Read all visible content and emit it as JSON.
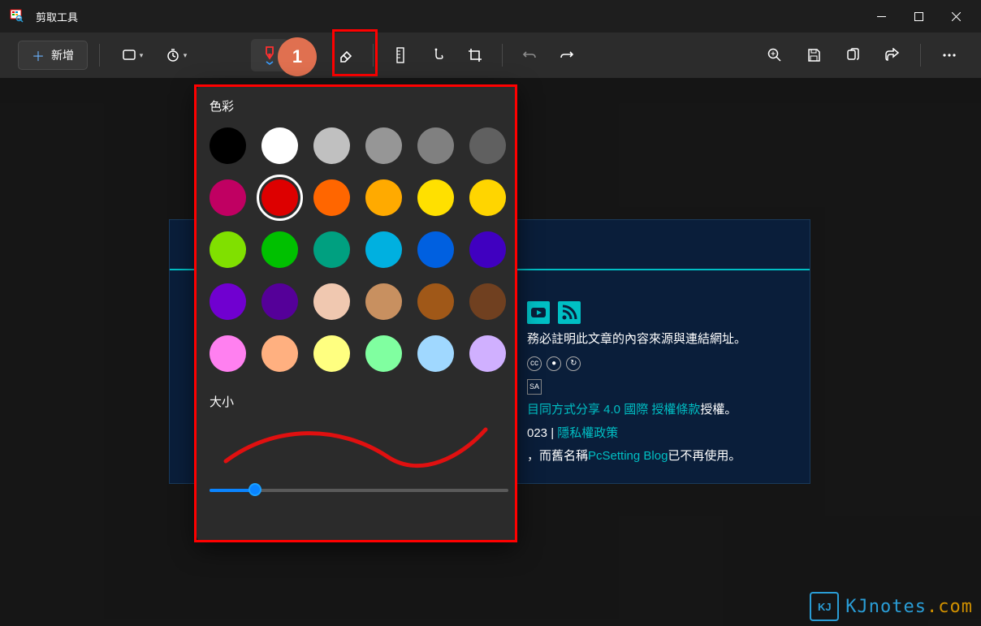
{
  "window": {
    "title": "剪取工具"
  },
  "toolbar": {
    "new_label": "新增"
  },
  "callout": {
    "num": "1"
  },
  "popup": {
    "color_title": "色彩",
    "size_title": "大小",
    "colors": [
      "#000000",
      "#ffffff",
      "#c0c0c0",
      "#969696",
      "#808080",
      "#606060",
      "#c00062",
      "#dd0000",
      "#ff6600",
      "#ffaa00",
      "#ffe000",
      "#ffd500",
      "#80e000",
      "#00c000",
      "#00a080",
      "#00b0e0",
      "#0060e0",
      "#4000c0",
      "#7000d0",
      "#550099",
      "#f0c8b0",
      "#c89060",
      "#a05818",
      "#704020",
      "#ff80f0",
      "#ffb080",
      "#ffff80",
      "#80ffa0",
      "#a0d8ff",
      "#d0b0ff"
    ],
    "selected_color_index": 7
  },
  "page": {
    "line1": "務必註明此文章的內容來源與連結網址。",
    "license_a": "目同方式分享 4.0 國際 授權條款",
    "license_b": "授權。",
    "year": "023 | ",
    "privacy": "隱私權政策",
    "rename_a": "，而舊名稱",
    "rename_b": "PcSetting Blog",
    "rename_c": "已不再使用。"
  },
  "watermark": {
    "icon_letters": "KJ",
    "text_a": "KJnotes",
    "text_b": ".com"
  }
}
